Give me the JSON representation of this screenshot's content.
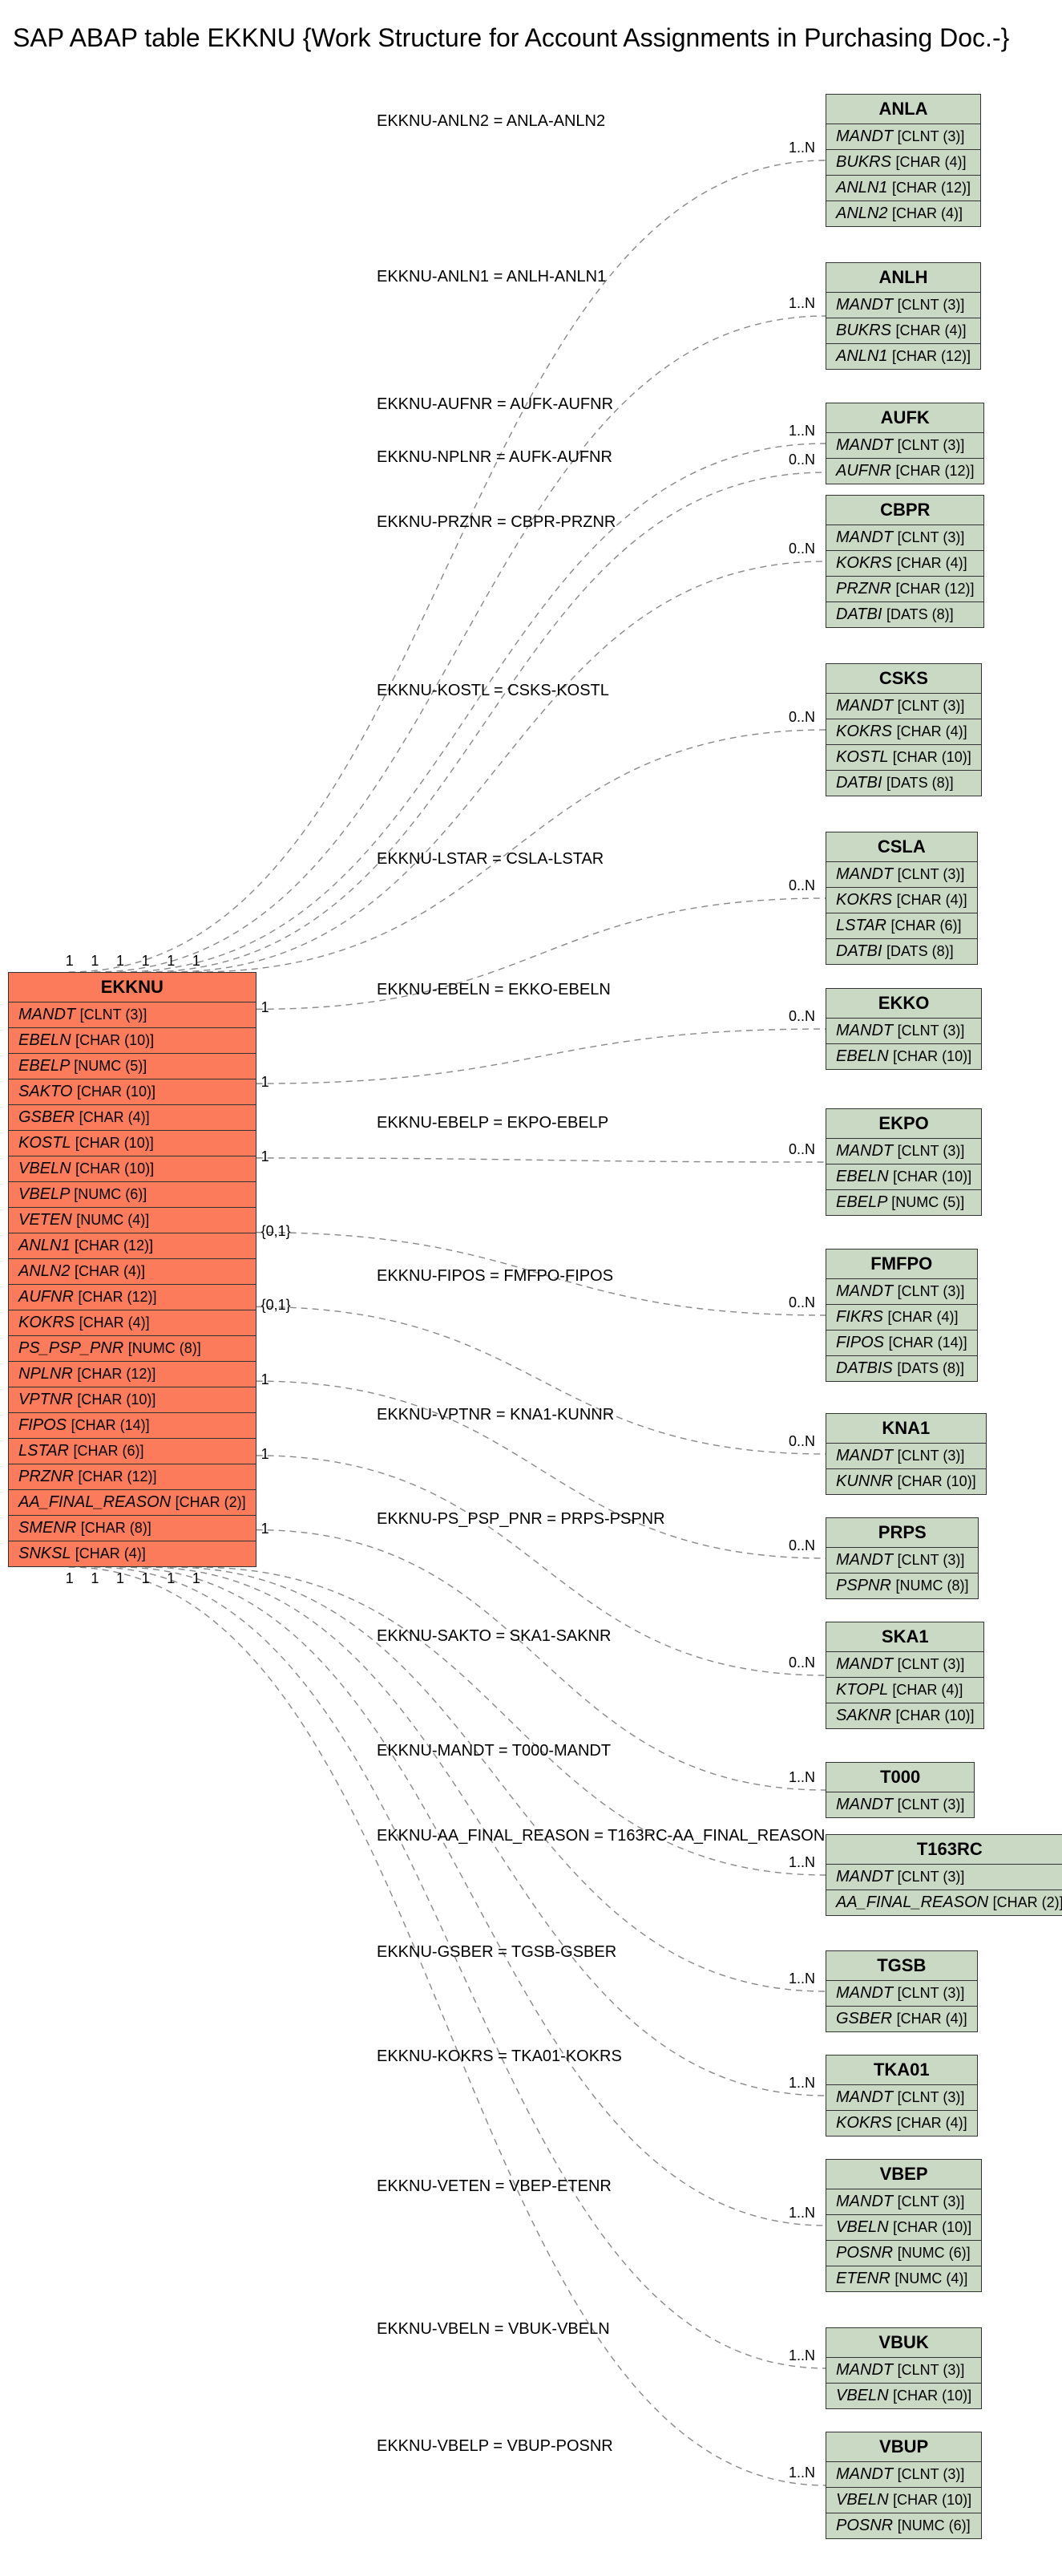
{
  "title": "SAP ABAP table EKKNU {Work Structure for Account Assignments in Purchasing Doc.-}",
  "main_entity": {
    "name": "EKKNU",
    "fields": [
      "MANDT [CLNT (3)]",
      "EBELN [CHAR (10)]",
      "EBELP [NUMC (5)]",
      "SAKTO [CHAR (10)]",
      "GSBER [CHAR (4)]",
      "KOSTL [CHAR (10)]",
      "VBELN [CHAR (10)]",
      "VBELP [NUMC (6)]",
      "VETEN [NUMC (4)]",
      "ANLN1 [CHAR (12)]",
      "ANLN2 [CHAR (4)]",
      "AUFNR [CHAR (12)]",
      "KOKRS [CHAR (4)]",
      "PS_PSP_PNR [NUMC (8)]",
      "NPLNR [CHAR (12)]",
      "VPTNR [CHAR (10)]",
      "FIPOS [CHAR (14)]",
      "LSTAR [CHAR (6)]",
      "PRZNR [CHAR (12)]",
      "AA_FINAL_REASON [CHAR (2)]",
      "SMENR [CHAR (8)]",
      "SNKSL [CHAR (4)]"
    ]
  },
  "related_entities": [
    {
      "name": "ANLA",
      "fields": [
        "MANDT [CLNT (3)]",
        "BUKRS [CHAR (4)]",
        "ANLN1 [CHAR (12)]",
        "ANLN2 [CHAR (4)]"
      ]
    },
    {
      "name": "ANLH",
      "fields": [
        "MANDT [CLNT (3)]",
        "BUKRS [CHAR (4)]",
        "ANLN1 [CHAR (12)]"
      ]
    },
    {
      "name": "AUFK",
      "fields": [
        "MANDT [CLNT (3)]",
        "AUFNR [CHAR (12)]"
      ]
    },
    {
      "name": "CBPR",
      "fields": [
        "MANDT [CLNT (3)]",
        "KOKRS [CHAR (4)]",
        "PRZNR [CHAR (12)]",
        "DATBI [DATS (8)]"
      ]
    },
    {
      "name": "CSKS",
      "fields": [
        "MANDT [CLNT (3)]",
        "KOKRS [CHAR (4)]",
        "KOSTL [CHAR (10)]",
        "DATBI [DATS (8)]"
      ]
    },
    {
      "name": "CSLA",
      "fields": [
        "MANDT [CLNT (3)]",
        "KOKRS [CHAR (4)]",
        "LSTAR [CHAR (6)]",
        "DATBI [DATS (8)]"
      ]
    },
    {
      "name": "EKKO",
      "fields": [
        "MANDT [CLNT (3)]",
        "EBELN [CHAR (10)]"
      ]
    },
    {
      "name": "EKPO",
      "fields": [
        "MANDT [CLNT (3)]",
        "EBELN [CHAR (10)]",
        "EBELP [NUMC (5)]"
      ]
    },
    {
      "name": "FMFPO",
      "fields": [
        "MANDT [CLNT (3)]",
        "FIKRS [CHAR (4)]",
        "FIPOS [CHAR (14)]",
        "DATBIS [DATS (8)]"
      ]
    },
    {
      "name": "KNA1",
      "fields": [
        "MANDT [CLNT (3)]",
        "KUNNR [CHAR (10)]"
      ]
    },
    {
      "name": "PRPS",
      "fields": [
        "MANDT [CLNT (3)]",
        "PSPNR [NUMC (8)]"
      ]
    },
    {
      "name": "SKA1",
      "fields": [
        "MANDT [CLNT (3)]",
        "KTOPL [CHAR (4)]",
        "SAKNR [CHAR (10)]"
      ]
    },
    {
      "name": "T000",
      "fields": [
        "MANDT [CLNT (3)]"
      ]
    },
    {
      "name": "T163RC",
      "fields": [
        "MANDT [CLNT (3)]",
        "AA_FINAL_REASON [CHAR (2)]"
      ]
    },
    {
      "name": "TGSB",
      "fields": [
        "MANDT [CLNT (3)]",
        "GSBER [CHAR (4)]"
      ]
    },
    {
      "name": "TKA01",
      "fields": [
        "MANDT [CLNT (3)]",
        "KOKRS [CHAR (4)]"
      ]
    },
    {
      "name": "VBEP",
      "fields": [
        "MANDT [CLNT (3)]",
        "VBELN [CHAR (10)]",
        "POSNR [NUMC (6)]",
        "ETENR [NUMC (4)]"
      ]
    },
    {
      "name": "VBUK",
      "fields": [
        "MANDT [CLNT (3)]",
        "VBELN [CHAR (10)]"
      ]
    },
    {
      "name": "VBUP",
      "fields": [
        "MANDT [CLNT (3)]",
        "VBELN [CHAR (10)]",
        "POSNR [NUMC (6)]"
      ]
    }
  ],
  "relations": [
    {
      "label": "EKKNU-ANLN2 = ANLA-ANLN2",
      "right_card": "1..N"
    },
    {
      "label": "EKKNU-ANLN1 = ANLH-ANLN1",
      "right_card": "1..N"
    },
    {
      "label": "EKKNU-AUFNR = AUFK-AUFNR",
      "right_card": "1..N"
    },
    {
      "label": "EKKNU-NPLNR = AUFK-AUFNR",
      "right_card": "0..N"
    },
    {
      "label": "EKKNU-PRZNR = CBPR-PRZNR",
      "right_card": "0..N"
    },
    {
      "label": "EKKNU-KOSTL = CSKS-KOSTL",
      "right_card": "0..N"
    },
    {
      "label": "EKKNU-LSTAR = CSLA-LSTAR",
      "right_card": "0..N"
    },
    {
      "label": "EKKNU-EBELN = EKKO-EBELN",
      "right_card": "0..N"
    },
    {
      "label": "EKKNU-EBELP = EKPO-EBELP",
      "right_card": "0..N"
    },
    {
      "label": "EKKNU-FIPOS = FMFPO-FIPOS",
      "right_card": "0..N"
    },
    {
      "label": "EKKNU-VPTNR = KNA1-KUNNR",
      "right_card": "0..N"
    },
    {
      "label": "EKKNU-PS_PSP_PNR = PRPS-PSPNR",
      "right_card": "0..N"
    },
    {
      "label": "EKKNU-SAKTO = SKA1-SAKNR",
      "right_card": "0..N"
    },
    {
      "label": "EKKNU-MANDT = T000-MANDT",
      "right_card": "1..N"
    },
    {
      "label": "EKKNU-AA_FINAL_REASON = T163RC-AA_FINAL_REASON",
      "right_card": "1..N"
    },
    {
      "label": "EKKNU-GSBER = TGSB-GSBER",
      "right_card": "1..N"
    },
    {
      "label": "EKKNU-KOKRS = TKA01-KOKRS",
      "right_card": "1..N"
    },
    {
      "label": "EKKNU-VETEN = VBEP-ETENR",
      "right_card": "1..N"
    },
    {
      "label": "EKKNU-VBELN = VBUK-VBELN",
      "right_card": "1..N"
    },
    {
      "label": "EKKNU-VBELP = VBUP-POSNR",
      "right_card": "1..N"
    }
  ],
  "left_cards_top": [
    "1",
    "1",
    "1",
    "1",
    "1",
    "1"
  ],
  "left_cards_right": [
    "1",
    "1",
    "1",
    "{0,1}",
    "{0,1}",
    "1",
    "1",
    "1"
  ],
  "left_cards_bottom": [
    "1",
    "1",
    "1",
    "1",
    "1",
    "1"
  ]
}
